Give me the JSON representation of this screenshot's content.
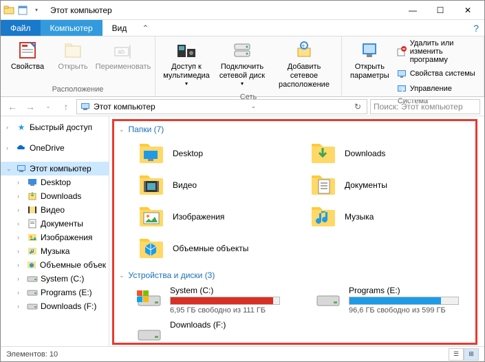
{
  "title": "Этот компьютер",
  "tabs": {
    "file": "Файл",
    "computer": "Компьютер",
    "view": "Вид"
  },
  "ribbon": {
    "group1": {
      "label": "Расположение",
      "props": "Свойства",
      "open": "Открыть",
      "rename": "Переименовать"
    },
    "group2": {
      "label": "Сеть",
      "media": "Доступ к мультимедиа",
      "mapdrive": "Подключить сетевой диск",
      "addnet": "Добавить сетевое расположение"
    },
    "group3": {
      "label": "Система",
      "openparams": "Открыть параметры",
      "uninstall": "Удалить или изменить программу",
      "sysprops": "Свойства системы",
      "manage": "Управление"
    }
  },
  "address": {
    "path": "Этот компьютер"
  },
  "search": {
    "placeholder": "Поиск: Этот компьютер"
  },
  "sidebar": {
    "quick": "Быстрый доступ",
    "onedrive": "OneDrive",
    "thispc": "Этот компьютер",
    "items": [
      {
        "label": "Desktop"
      },
      {
        "label": "Downloads"
      },
      {
        "label": "Видео"
      },
      {
        "label": "Документы"
      },
      {
        "label": "Изображения"
      },
      {
        "label": "Музыка"
      },
      {
        "label": "Объемные объек"
      },
      {
        "label": "System (C:)"
      },
      {
        "label": "Programs (E:)"
      },
      {
        "label": "Downloads (F:)"
      }
    ]
  },
  "groups": {
    "folders": {
      "title": "Папки (7)",
      "items": [
        {
          "name": "Desktop",
          "kind": "desktop"
        },
        {
          "name": "Downloads",
          "kind": "downloads"
        },
        {
          "name": "Видео",
          "kind": "video"
        },
        {
          "name": "Документы",
          "kind": "documents"
        },
        {
          "name": "Изображения",
          "kind": "pictures"
        },
        {
          "name": "Музыка",
          "kind": "music"
        },
        {
          "name": "Объемные объекты",
          "kind": "3d"
        }
      ]
    },
    "drives": {
      "title": "Устройства и диски (3)",
      "items": [
        {
          "name": "System (C:)",
          "free": "6,95 ГБ свободно из 111 ГБ",
          "pct": 94,
          "color": "#d93025",
          "os": true
        },
        {
          "name": "Programs (E:)",
          "free": "96,6 ГБ свободно из 599 ГБ",
          "pct": 84,
          "color": "#1e9be7",
          "os": false
        },
        {
          "name": "Downloads (F:)",
          "free": "",
          "pct": 0,
          "color": "#1e9be7",
          "os": false
        }
      ]
    }
  },
  "status": "Элементов: 10"
}
